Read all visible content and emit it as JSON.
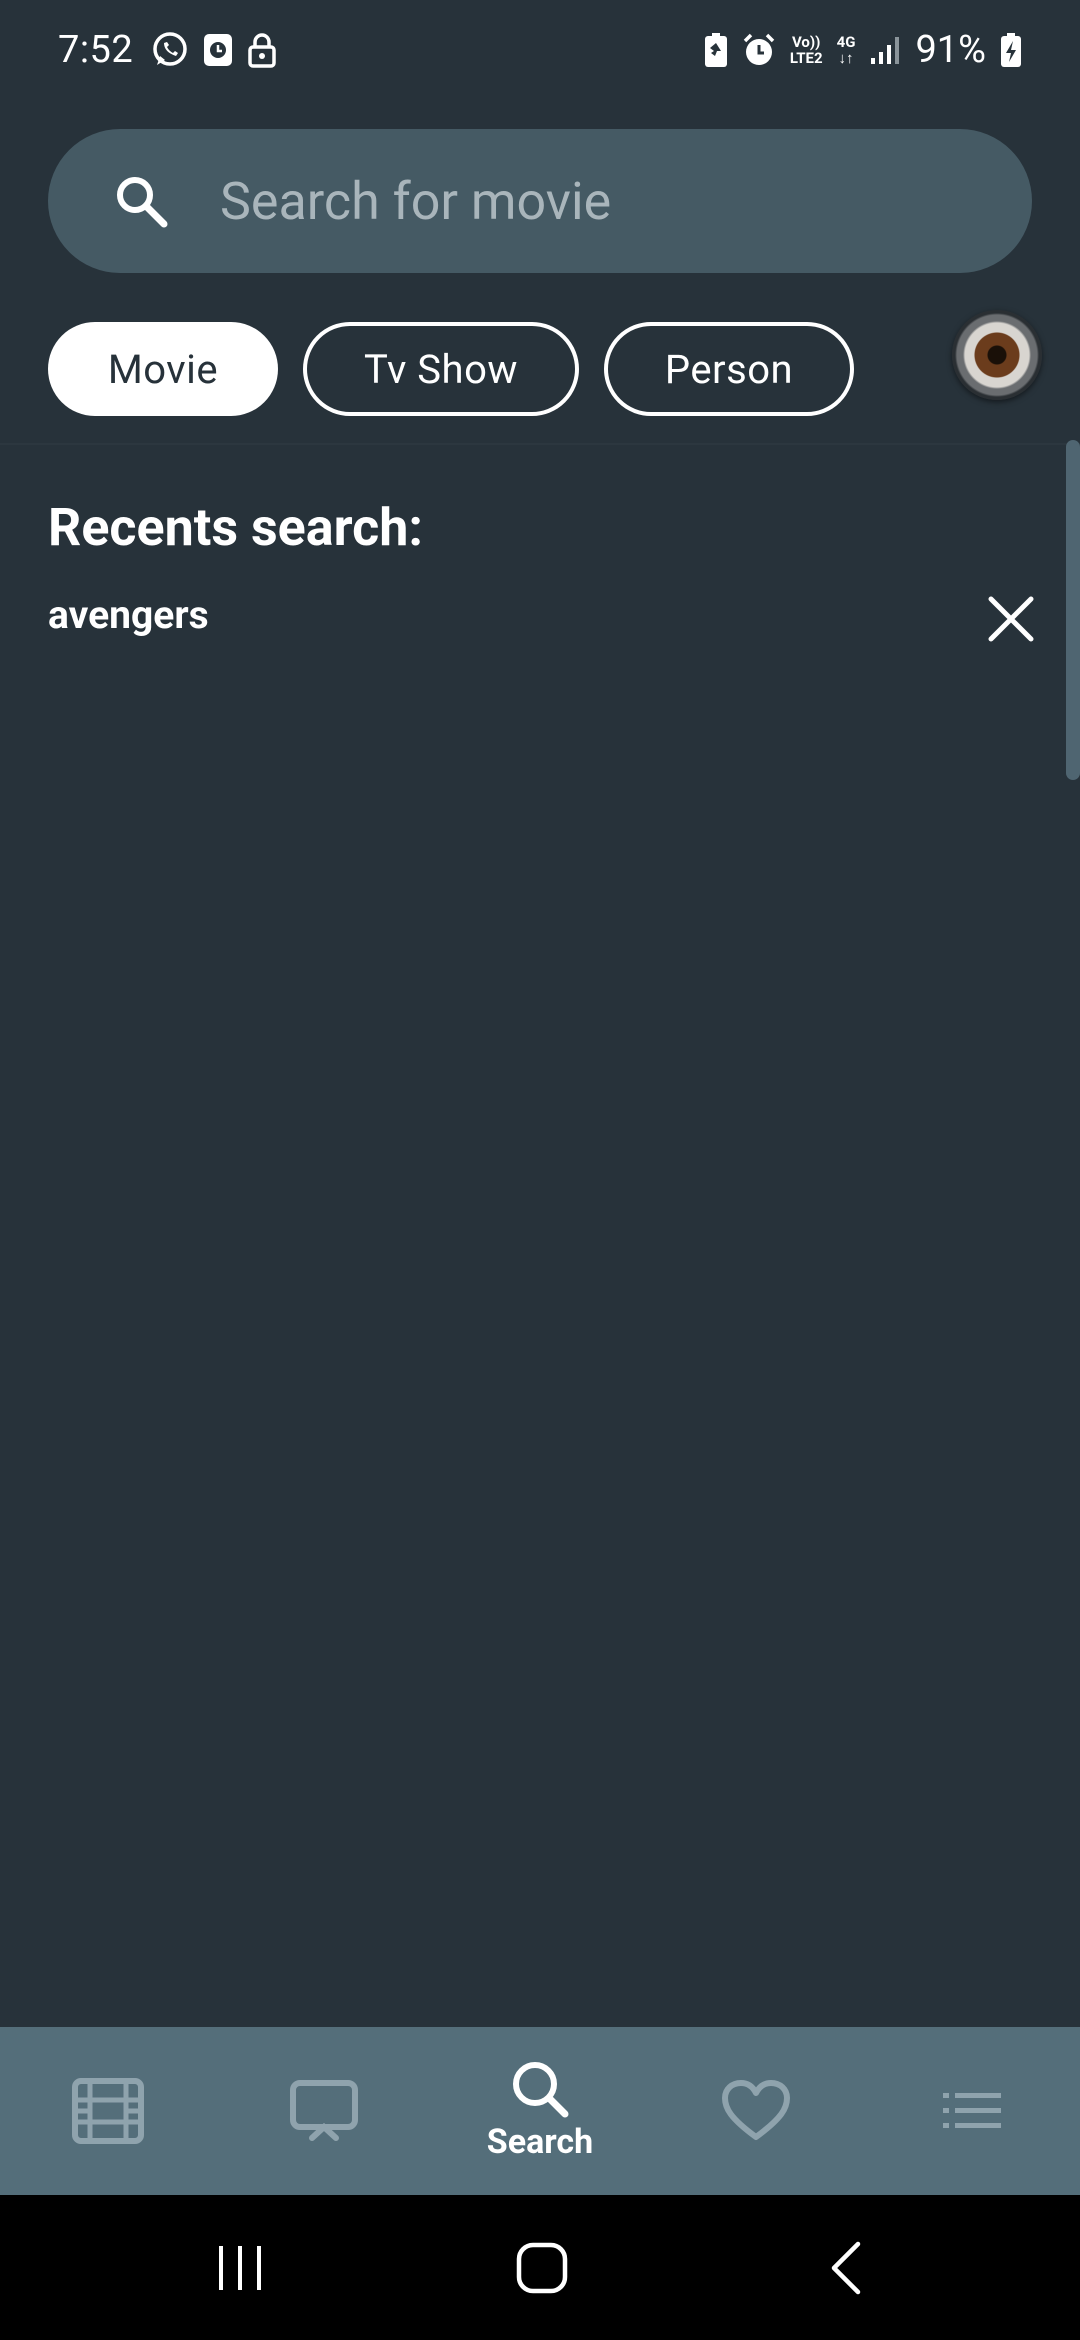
{
  "status_bar": {
    "time": "7:52",
    "battery_percent": "91%",
    "network_volte": "Vo))",
    "network_lte": "LTE2",
    "network_type": "4G",
    "icons": [
      "whatsapp-icon",
      "clock-app-icon",
      "lock-icon",
      "battery-saver-icon",
      "alarm-icon",
      "volte-icon",
      "data-arrows-icon",
      "signal-icon",
      "battery-charging-icon"
    ]
  },
  "search": {
    "placeholder": "Search for movie",
    "value": "",
    "icon": "search-icon"
  },
  "filters": [
    {
      "label": "Movie",
      "active": true
    },
    {
      "label": "Tv Show",
      "active": false
    },
    {
      "label": "Person",
      "active": false
    }
  ],
  "recents": {
    "title": "Recents search:",
    "items": [
      {
        "query": "avengers",
        "remove_icon": "close-icon"
      }
    ]
  },
  "bottom_nav": {
    "items": [
      {
        "name": "movies",
        "icon": "film-icon",
        "label": "",
        "active": false
      },
      {
        "name": "tv",
        "icon": "tv-icon",
        "label": "",
        "active": false
      },
      {
        "name": "search",
        "icon": "search-icon",
        "label": "Search",
        "active": true
      },
      {
        "name": "favorites",
        "icon": "heart-icon",
        "label": "",
        "active": false
      },
      {
        "name": "lists",
        "icon": "list-icon",
        "label": "",
        "active": false
      }
    ]
  },
  "colors": {
    "background": "#27323a",
    "search_bar": "#455a64",
    "bottom_nav": "#546e7a",
    "inactive_icon": "#8fa3ad",
    "active": "#ffffff"
  }
}
